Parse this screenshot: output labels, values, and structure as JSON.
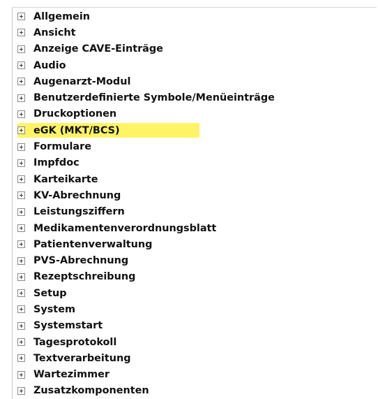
{
  "tree": {
    "items": [
      {
        "label": "Allgemein"
      },
      {
        "label": "Ansicht"
      },
      {
        "label": "Anzeige CAVE-Einträge"
      },
      {
        "label": "Audio"
      },
      {
        "label": "Augenarzt-Modul"
      },
      {
        "label": "Benutzerdefinierte Symbole/Menüeinträge"
      },
      {
        "label": "Druckoptionen"
      },
      {
        "label": "eGK (MKT/BCS)",
        "highlighted": true,
        "highlight_color": "#fff24a"
      },
      {
        "label": "Formulare"
      },
      {
        "label": "Impfdoc"
      },
      {
        "label": "Karteikarte"
      },
      {
        "label": "KV-Abrechnung"
      },
      {
        "label": "Leistungsziffern"
      },
      {
        "label": "Medikamentenverordnungsblatt"
      },
      {
        "label": "Patientenverwaltung"
      },
      {
        "label": "PVS-Abrechnung"
      },
      {
        "label": "Rezeptschreibung"
      },
      {
        "label": "Setup"
      },
      {
        "label": "System"
      },
      {
        "label": "Systemstart"
      },
      {
        "label": "Tagesprotokoll"
      },
      {
        "label": "Textverarbeitung"
      },
      {
        "label": "Wartezimmer"
      },
      {
        "label": "Zusatzkomponenten"
      }
    ],
    "expander_icon": "plus-box-icon"
  }
}
